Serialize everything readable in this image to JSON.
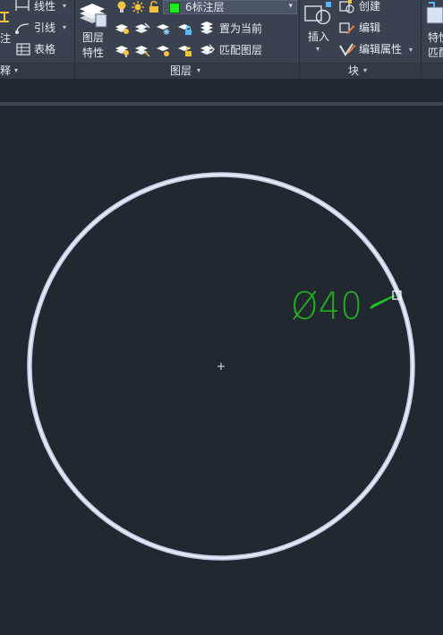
{
  "ribbon": {
    "annotation_panel": {
      "label": "释",
      "left_fragment": "注",
      "items": [
        {
          "label": "线性"
        },
        {
          "label": "引线"
        },
        {
          "label": "表格"
        }
      ]
    },
    "layers_panel": {
      "label": "图层",
      "layer_properties_label_line1": "图层",
      "layer_properties_label_line2": "特性",
      "current_layer": "6标注层",
      "current_layer_color": "#1fe81f",
      "set_current_label": "置为当前",
      "match_layer_label": "匹配图层"
    },
    "block_panel": {
      "label": "块",
      "insert_label": "插入",
      "create_label": "创建",
      "edit_label": "编辑",
      "edit_attributes_label": "编辑属性"
    },
    "properties_panel": {
      "label_line1": "特性",
      "label_line2": "匹配"
    }
  },
  "drawing": {
    "dimension_text": "Ø40",
    "dimension_color": "#22b022",
    "circle_color": "#cfd8f0"
  }
}
